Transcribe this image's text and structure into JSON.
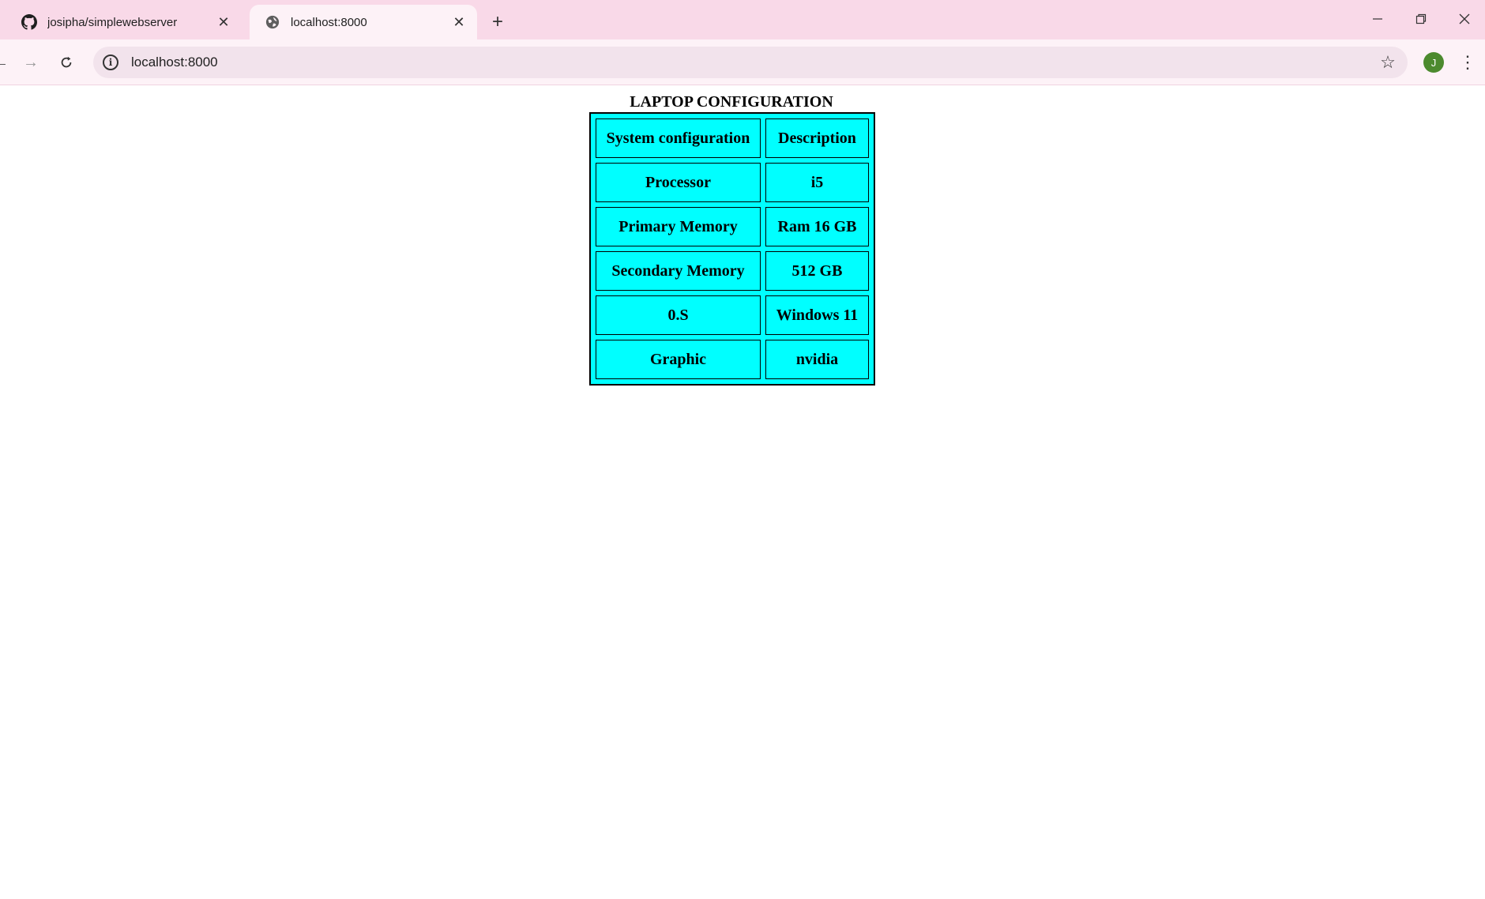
{
  "browser": {
    "tabs": [
      {
        "title": "josipha/simplewebserver",
        "favicon": "github-icon",
        "active": false
      },
      {
        "title": "localhost:8000",
        "favicon": "globe-icon",
        "active": true
      }
    ],
    "address": "localhost:8000",
    "profile_initial": "J"
  },
  "page": {
    "caption": "LAPTOP CONFIGURATION",
    "rows": [
      [
        "System configuration",
        "Description"
      ],
      [
        "Processor",
        "i5"
      ],
      [
        "Primary Memory",
        "Ram 16 GB"
      ],
      [
        "Secondary Memory",
        "512 GB"
      ],
      [
        "0.S",
        "Windows 11"
      ],
      [
        "Graphic",
        "nvidia"
      ]
    ]
  },
  "colors": {
    "tabbar_bg": "#f9d9e8",
    "table_bg": "#00ffff",
    "avatar_bg": "#4c8a2e"
  }
}
